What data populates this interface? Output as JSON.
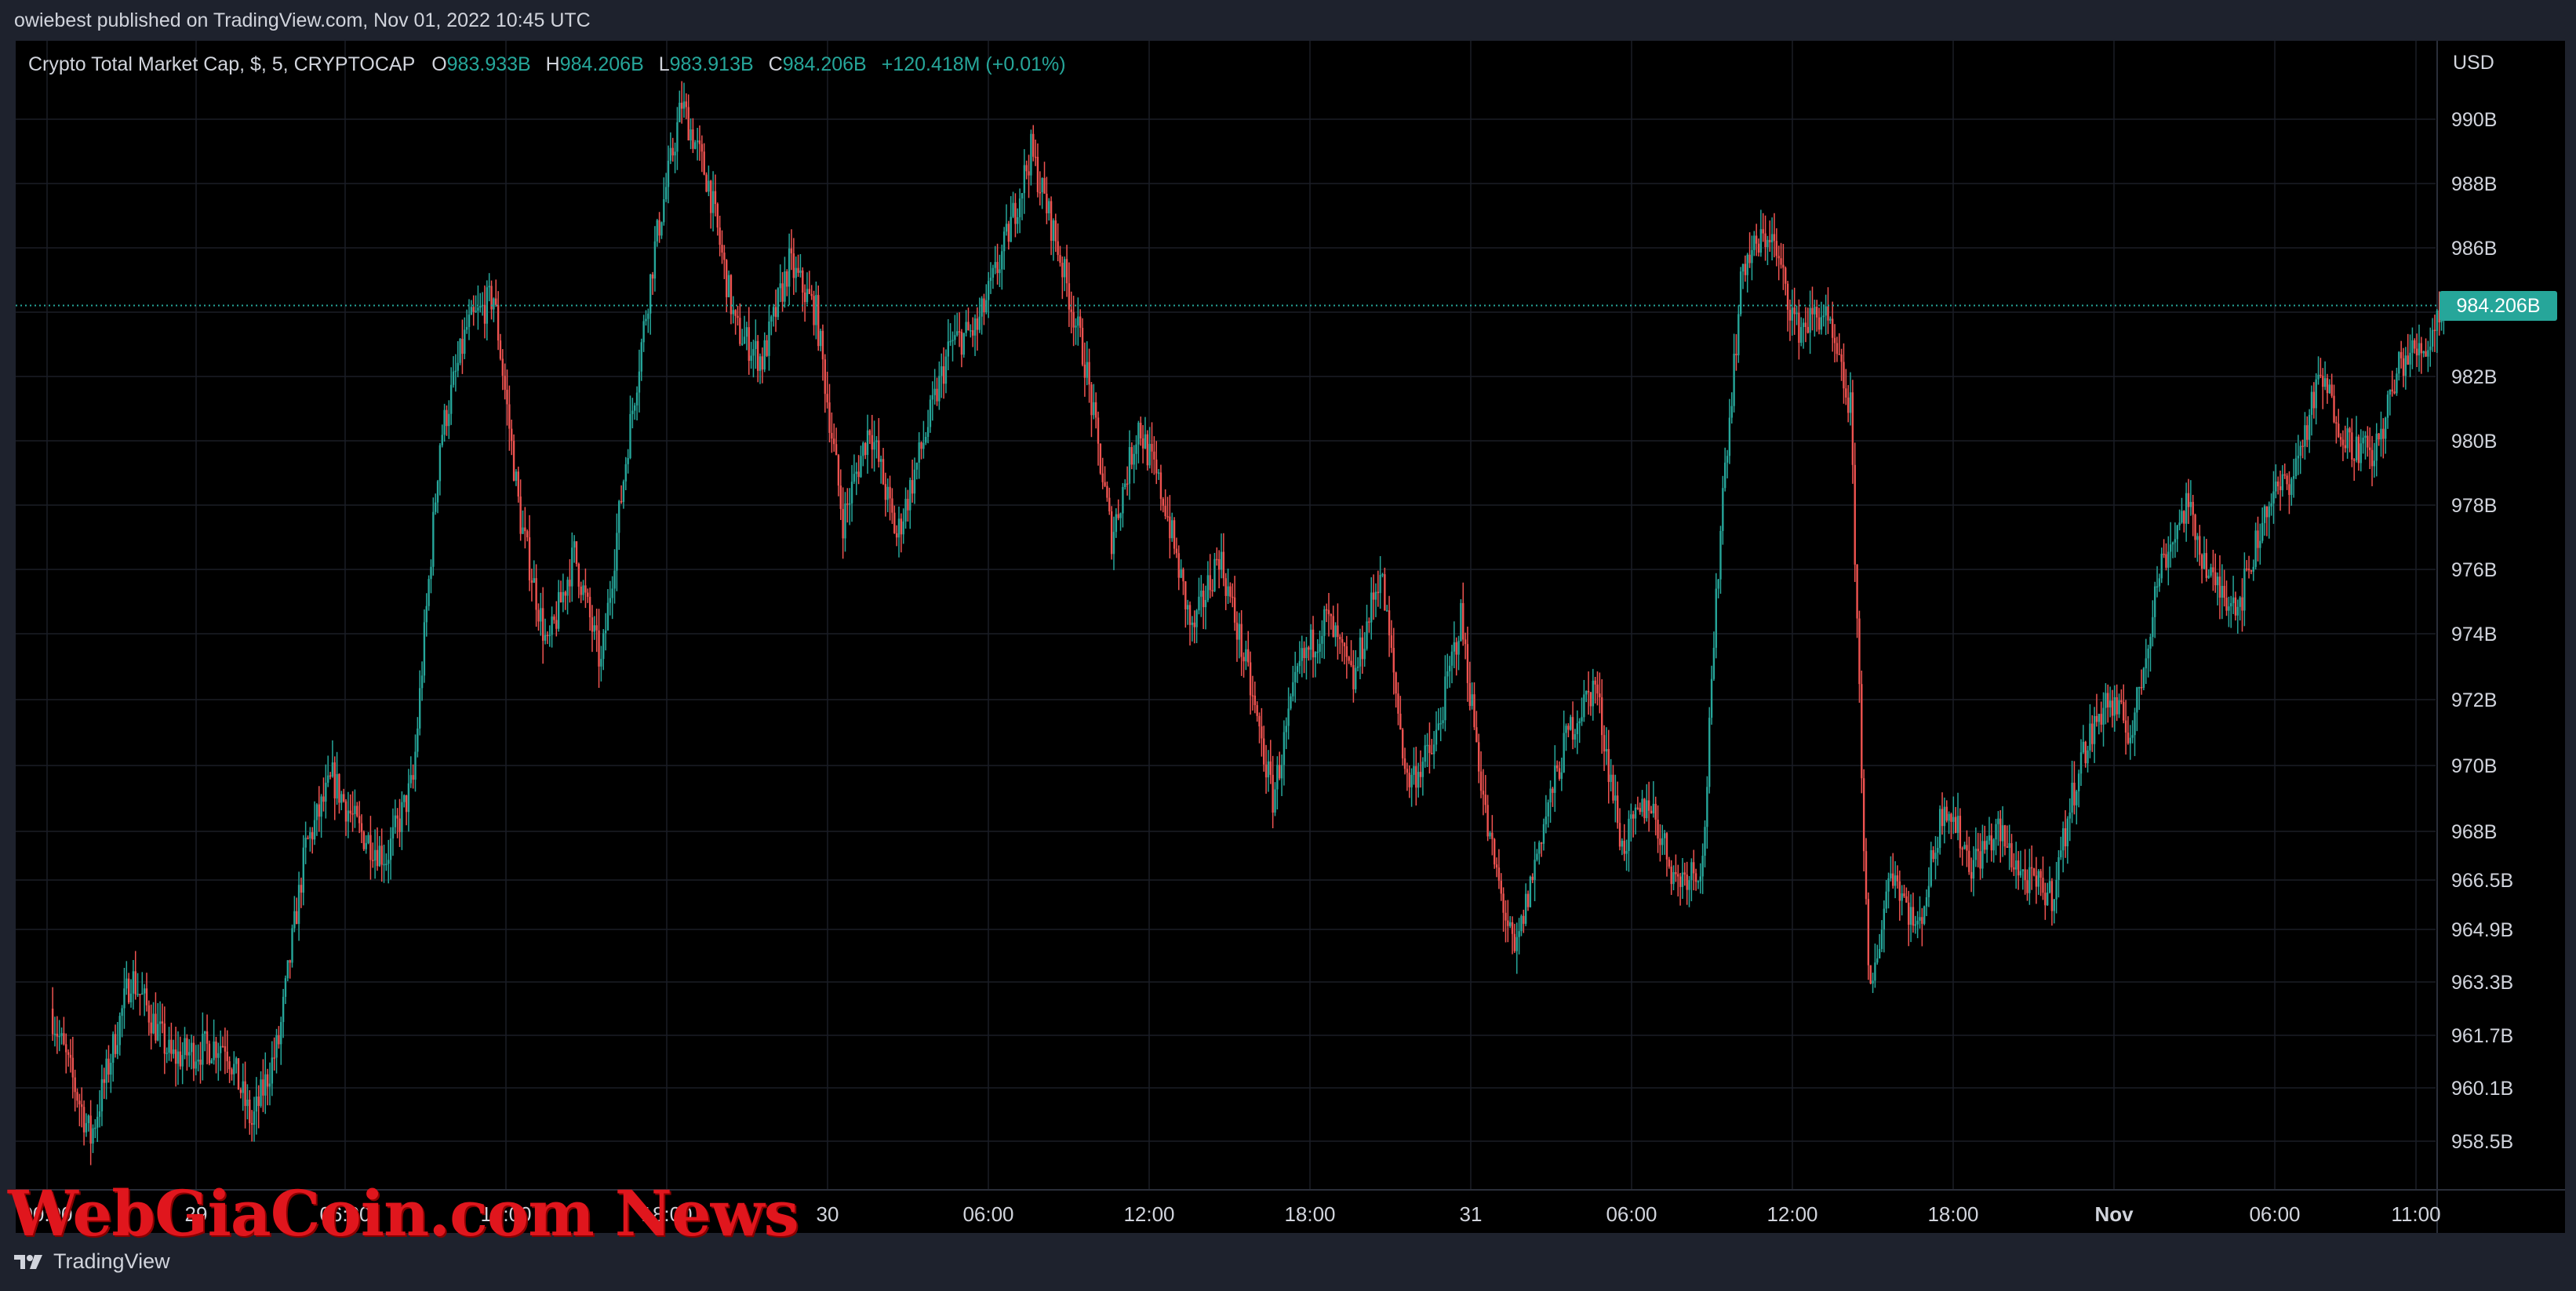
{
  "published": "owiebest published on TradingView.com, Nov 01, 2022 10:45 UTC",
  "header": {
    "symbol": "Crypto Total Market Cap, $, 5, CRYPTOCAP",
    "open_key": "O",
    "open": "983.933B",
    "high_key": "H",
    "high": "984.206B",
    "low_key": "L",
    "low": "983.913B",
    "close_key": "C",
    "close": "984.206B",
    "change": "+120.418M (+0.01%)"
  },
  "currency": "USD",
  "last_price_label": "984.206B",
  "watermark": "WebGiaCoin.com News",
  "footer": {
    "brand": "TradingView"
  },
  "colors": {
    "up": "#26a69a",
    "down": "#ef5350",
    "background": "#000000",
    "grid": "#1a1d26",
    "watermark": "#e0161d"
  },
  "chart_data": {
    "type": "candlestick",
    "interval": "5",
    "symbol": "CRYPTOCAP",
    "currency": "USD",
    "y_ticks": [
      {
        "label": "990B",
        "value": 990
      },
      {
        "label": "988B",
        "value": 988
      },
      {
        "label": "986B",
        "value": 986
      },
      {
        "label": "984B",
        "value": 984
      },
      {
        "label": "982B",
        "value": 982
      },
      {
        "label": "980B",
        "value": 980
      },
      {
        "label": "978B",
        "value": 978
      },
      {
        "label": "976B",
        "value": 976
      },
      {
        "label": "974B",
        "value": 974
      },
      {
        "label": "972B",
        "value": 972
      },
      {
        "label": "970B",
        "value": 970
      },
      {
        "label": "968B",
        "value": 968
      },
      {
        "label": "966.5B",
        "value": 966.5
      },
      {
        "label": "964.9B",
        "value": 964.9
      },
      {
        "label": "963.3B",
        "value": 963.3
      },
      {
        "label": "961.7B",
        "value": 961.7
      },
      {
        "label": "960.1B",
        "value": 960.1
      },
      {
        "label": "958.5B",
        "value": 958.5
      }
    ],
    "x_ticks": [
      {
        "label": "00:00",
        "hours": 0
      },
      {
        "label": "29",
        "hours": 0
      },
      {
        "label": "06:00",
        "hours": 6
      },
      {
        "label": "12:00",
        "hours": 12
      },
      {
        "label": "18:00",
        "hours": 18
      },
      {
        "label": "30",
        "hours": 24
      },
      {
        "label": "06:00",
        "hours": 30
      },
      {
        "label": "12:00",
        "hours": 36
      },
      {
        "label": "18:00",
        "hours": 42
      },
      {
        "label": "31",
        "hours": 48
      },
      {
        "label": "06:00",
        "hours": 54
      },
      {
        "label": "12:00",
        "hours": 60
      },
      {
        "label": "18:00",
        "hours": 66
      },
      {
        "label": "Nov",
        "hours": 72
      },
      {
        "label": "06:00",
        "hours": 78
      },
      {
        "label": "11:00",
        "hours": 83
      }
    ],
    "last_price": 984.206,
    "path_keypoints": [
      [
        0.5,
        962.5
      ],
      [
        2,
        958.6
      ],
      [
        3.5,
        963.5
      ],
      [
        5,
        961.0
      ],
      [
        7,
        961.5
      ],
      [
        8,
        959.0
      ],
      [
        9,
        961.5
      ],
      [
        10,
        967.5
      ],
      [
        11,
        969.6
      ],
      [
        12,
        968.0
      ],
      [
        13,
        967.2
      ],
      [
        14,
        969.5
      ],
      [
        15,
        980.0
      ],
      [
        16,
        983.5
      ],
      [
        17,
        984.5
      ],
      [
        18,
        977.5
      ],
      [
        19,
        973.5
      ],
      [
        20,
        976.5
      ],
      [
        21,
        973.0
      ],
      [
        22,
        980.0
      ],
      [
        23,
        986.0
      ],
      [
        24,
        990.5
      ],
      [
        25,
        988.0
      ],
      [
        26,
        983.5
      ],
      [
        27,
        982.5
      ],
      [
        28,
        985.5
      ],
      [
        29,
        984.0
      ],
      [
        30,
        977.5
      ],
      [
        31,
        980.5
      ],
      [
        32,
        977.0
      ],
      [
        33,
        980.0
      ],
      [
        34,
        983.0
      ],
      [
        35,
        983.5
      ],
      [
        36,
        986.0
      ],
      [
        37,
        989.0
      ],
      [
        38,
        986.0
      ],
      [
        39,
        982.5
      ],
      [
        40,
        977.0
      ],
      [
        41,
        980.5
      ],
      [
        42,
        978.0
      ],
      [
        43,
        974.0
      ],
      [
        44,
        976.5
      ],
      [
        45,
        973.0
      ],
      [
        46,
        969.0
      ],
      [
        47,
        973.0
      ],
      [
        48,
        974.5
      ],
      [
        49,
        972.5
      ],
      [
        50,
        976.0
      ],
      [
        51,
        969.5
      ],
      [
        52,
        970.5
      ],
      [
        53,
        974.5
      ],
      [
        54,
        968.0
      ],
      [
        55,
        964.0
      ],
      [
        56,
        968.0
      ],
      [
        57,
        971.0
      ],
      [
        58,
        972.5
      ],
      [
        59,
        967.5
      ],
      [
        60,
        969.0
      ],
      [
        61,
        966.5
      ],
      [
        62,
        967.0
      ],
      [
        62.7,
        978.0
      ],
      [
        63.5,
        985.5
      ],
      [
        64.5,
        986.5
      ],
      [
        65.5,
        983.5
      ],
      [
        66.5,
        984.0
      ],
      [
        67.5,
        981.0
      ],
      [
        68.2,
        962.5
      ],
      [
        69,
        967.0
      ],
      [
        70,
        964.8
      ],
      [
        71,
        969.0
      ],
      [
        72,
        967.0
      ],
      [
        73,
        968.0
      ],
      [
        74,
        966.5
      ],
      [
        75,
        966.0
      ],
      [
        76,
        970.0
      ],
      [
        77,
        972.0
      ],
      [
        78,
        971.0
      ],
      [
        79,
        976.0
      ],
      [
        80,
        978.0
      ],
      [
        81,
        975.5
      ],
      [
        82,
        975.0
      ],
      [
        83,
        978.0
      ],
      [
        84,
        979.0
      ],
      [
        85,
        982.0
      ],
      [
        86,
        980.0
      ],
      [
        87,
        979.5
      ],
      [
        88,
        982.5
      ],
      [
        89,
        983.0
      ],
      [
        89.5,
        984.206
      ]
    ]
  }
}
